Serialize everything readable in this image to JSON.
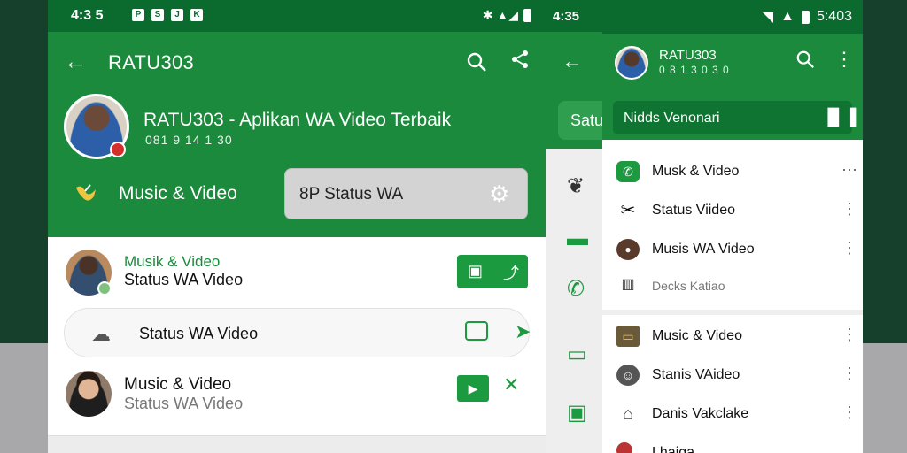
{
  "left_screen": {
    "status_bar": {
      "time": "4:3 5",
      "icons": [
        "P",
        "S",
        "J",
        "K"
      ],
      "right_icons": "✱ ▲◢"
    },
    "header": {
      "title": "RATU303"
    },
    "profile": {
      "name": "RATU303 - Aplikan WA Video Terbaik",
      "number": "081 9 14 1 30"
    },
    "music_label": "Music & Video",
    "status_pill": {
      "label": "8P Status WA"
    },
    "rows": [
      {
        "line1": "Musik & Video",
        "line2": "Status WA Video"
      },
      {
        "label": "Status WA Video"
      },
      {
        "line1": "Music & Video",
        "line2": "Status WA Video"
      }
    ]
  },
  "middle_screen": {
    "time": "4:35",
    "chip_label": "Satu"
  },
  "right_screen": {
    "status_bar": {
      "time": "5:403"
    },
    "header": {
      "name": "RATU303",
      "number": "0 8 1 3 0 3 0"
    },
    "search": {
      "placeholder": "Nidds Venonari"
    },
    "list_top": [
      {
        "label": "Musk & Video"
      },
      {
        "label": "Status Viideo"
      },
      {
        "label": "Musis WA Video"
      },
      {
        "label": "Decks Katiao"
      }
    ],
    "list_bottom": [
      {
        "label": "Music & Video"
      },
      {
        "label": "Stanis VAideo"
      },
      {
        "label": "Danis Vakclake"
      },
      {
        "label": "Lhaiga..."
      }
    ]
  },
  "colors": {
    "primary_green": "#1b8a3c",
    "dark_green": "#0b6b2e",
    "accent_green": "#1b9a40",
    "background_dark": "#17402c"
  }
}
